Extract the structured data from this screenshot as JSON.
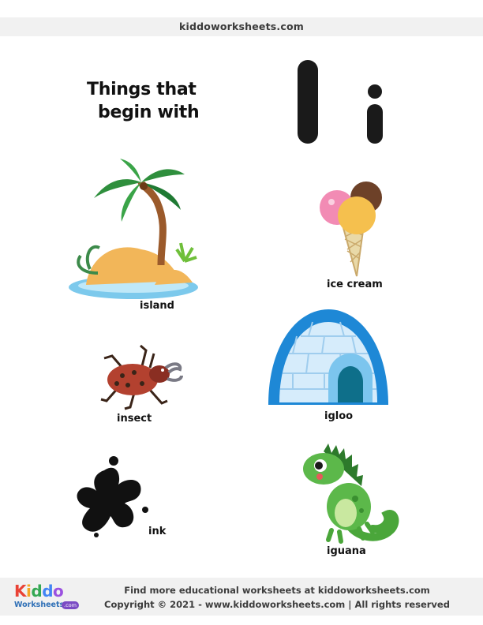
{
  "header": {
    "site": "kiddoworksheets.com"
  },
  "title": {
    "line1": "Things that",
    "line2": "begin with"
  },
  "letters": {
    "upper": "I",
    "lower": "i"
  },
  "items": [
    {
      "label": "island",
      "icon": "island-icon"
    },
    {
      "label": "ice cream",
      "icon": "ice-cream-icon"
    },
    {
      "label": "insect",
      "icon": "insect-icon"
    },
    {
      "label": "igloo",
      "icon": "igloo-icon"
    },
    {
      "label": "ink",
      "icon": "ink-splat-icon"
    },
    {
      "label": "iguana",
      "icon": "iguana-icon"
    }
  ],
  "footer": {
    "logo_word": "Kiddo",
    "logo_sub": "Worksheets",
    "logo_com": ".com",
    "line1": "Find more educational worksheets at kiddoworksheets.com",
    "line2": "Copyright © 2021 - www.kiddoworksheets.com  |  All rights reserved"
  },
  "colors": {
    "band": "#f1f1f1",
    "letter": "#1a1a1a",
    "accent_blue": "#2e6fb6"
  }
}
